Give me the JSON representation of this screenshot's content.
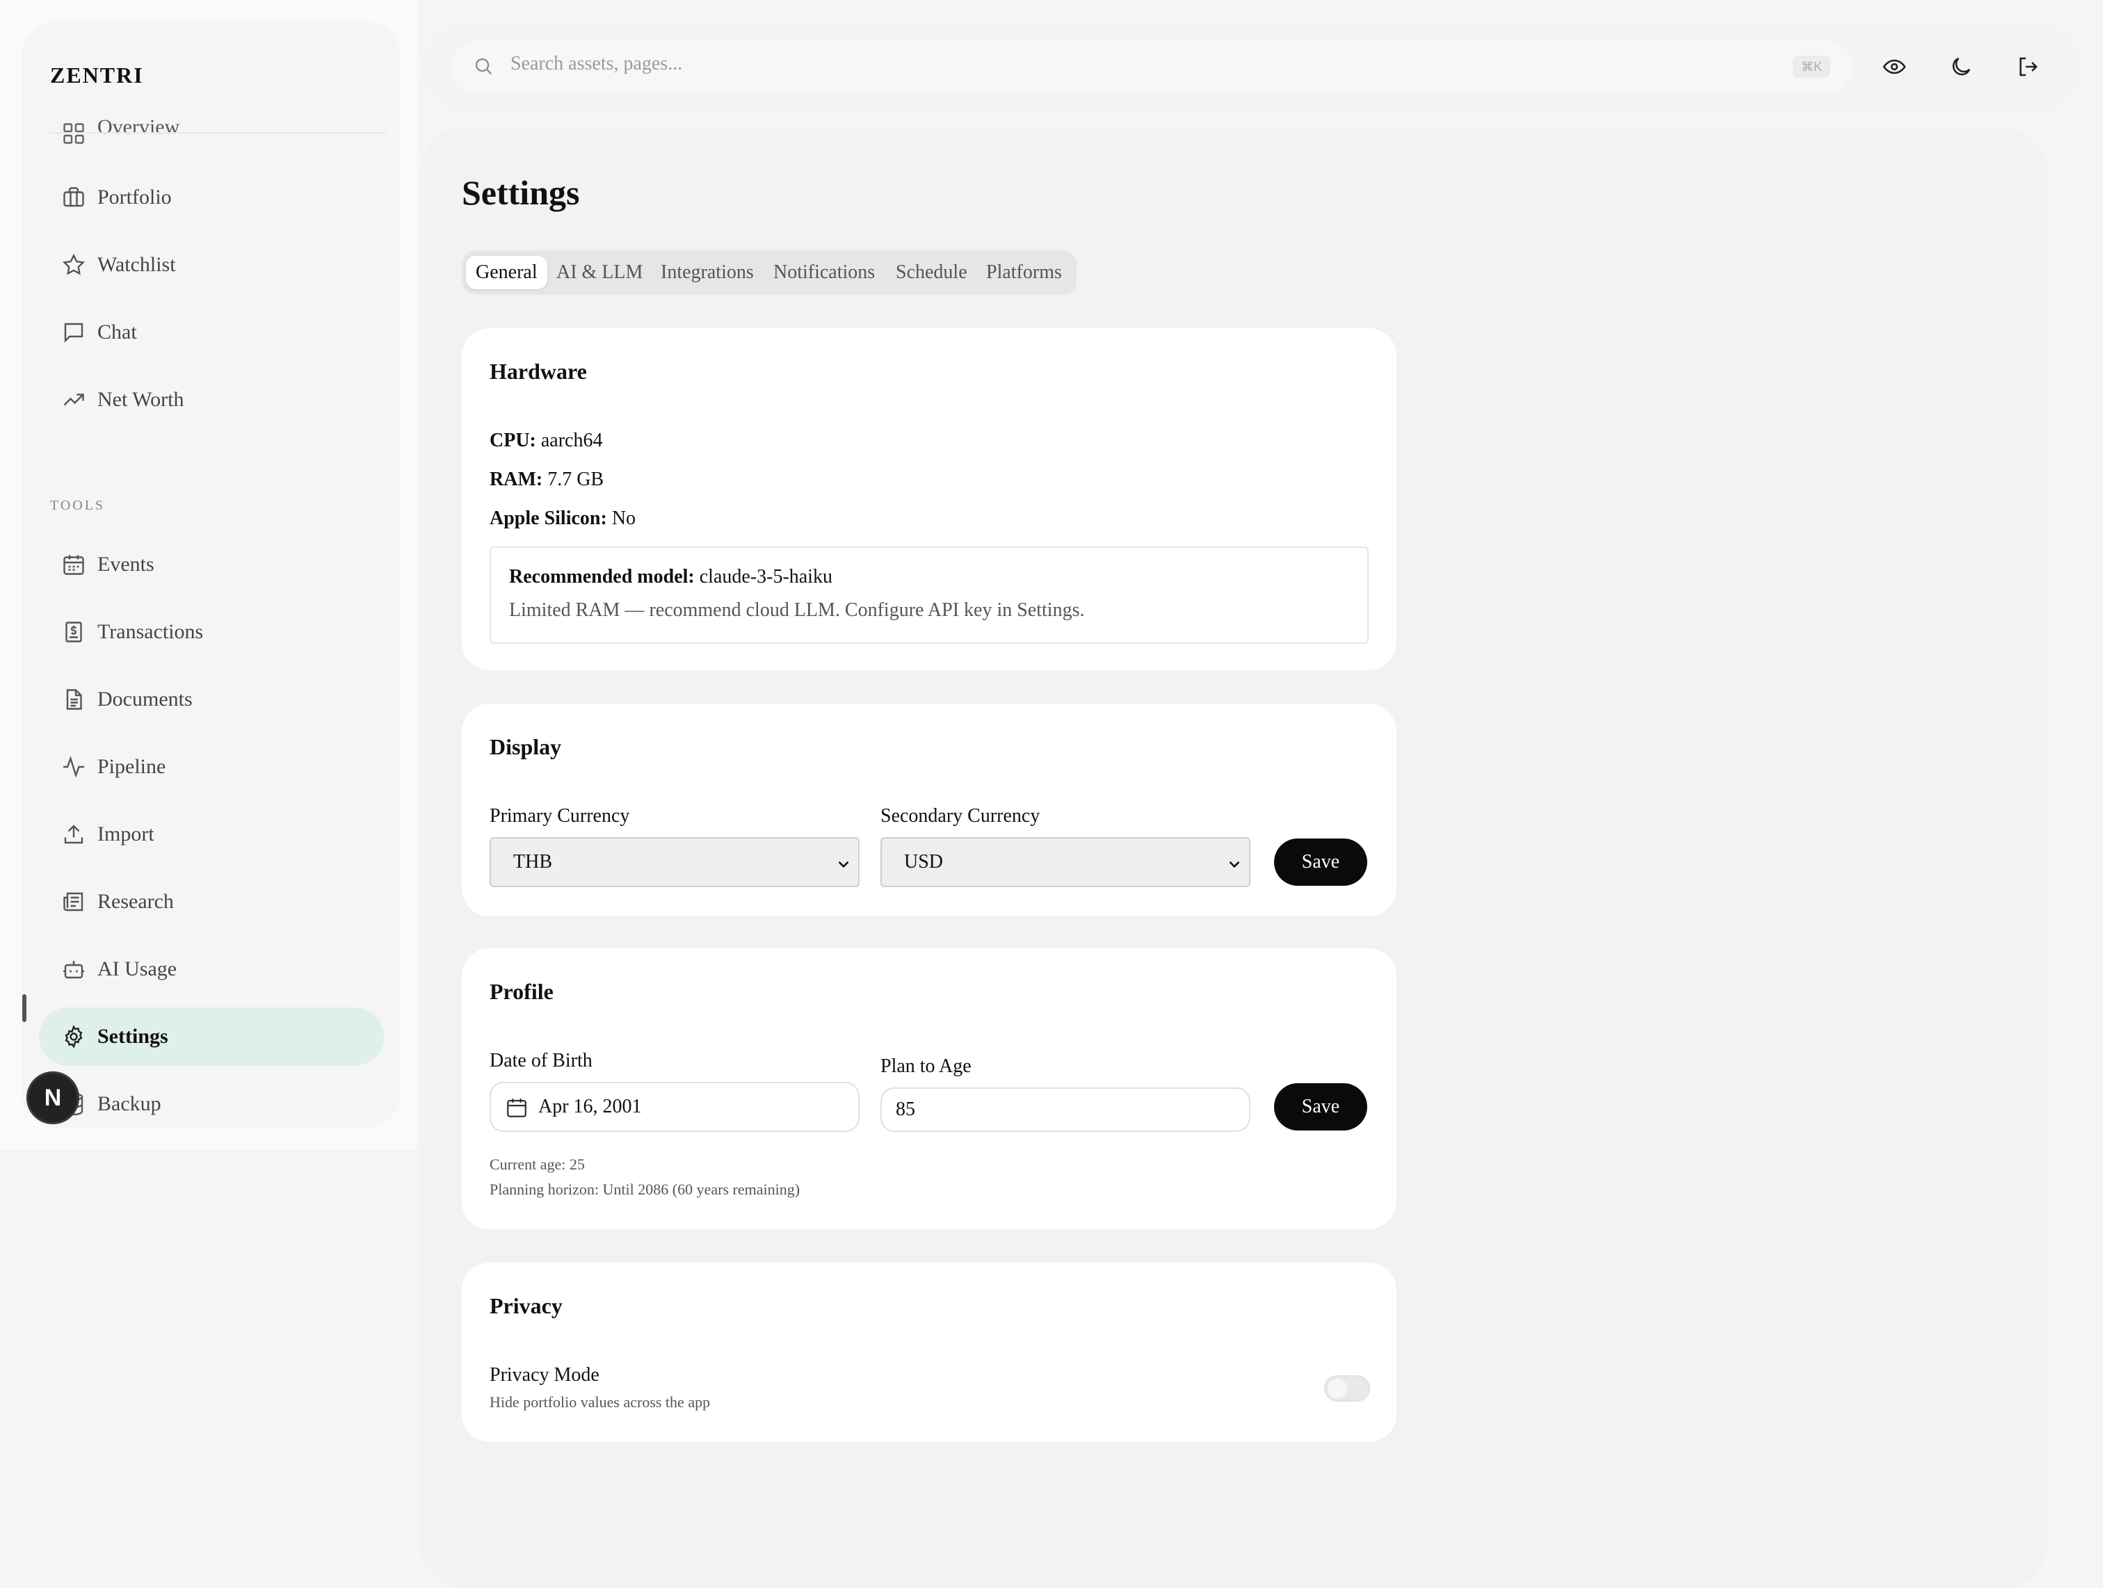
{
  "app": {
    "brand": "ZENTRI",
    "avatar_letter": "N"
  },
  "sidebar": {
    "items": [
      {
        "label": "Overview",
        "icon": "grid-icon"
      },
      {
        "label": "Portfolio",
        "icon": "briefcase-icon"
      },
      {
        "label": "Watchlist",
        "icon": "star-icon"
      },
      {
        "label": "Chat",
        "icon": "chat-icon"
      },
      {
        "label": "Net Worth",
        "icon": "trending-up-icon"
      }
    ],
    "tools_label": "TOOLS",
    "tools": [
      {
        "label": "Events",
        "icon": "calendar-icon"
      },
      {
        "label": "Transactions",
        "icon": "receipt-icon"
      },
      {
        "label": "Documents",
        "icon": "document-icon"
      },
      {
        "label": "Pipeline",
        "icon": "activity-icon"
      },
      {
        "label": "Import",
        "icon": "upload-icon"
      },
      {
        "label": "Research",
        "icon": "newspaper-icon"
      },
      {
        "label": "AI Usage",
        "icon": "bot-icon"
      },
      {
        "label": "Settings",
        "icon": "gear-icon",
        "active": true
      },
      {
        "label": "Backup",
        "icon": "database-icon"
      }
    ]
  },
  "topbar": {
    "search_placeholder": "Search assets, pages...",
    "search_shortcut": "⌘K",
    "icons": [
      "eye-icon",
      "moon-icon",
      "logout-icon"
    ]
  },
  "page": {
    "title": "Settings",
    "tabs": [
      "General",
      "AI & LLM",
      "Integrations",
      "Notifications",
      "Schedule",
      "Platforms"
    ],
    "active_tab": "General"
  },
  "hardware": {
    "title": "Hardware",
    "cpu_label": "CPU:",
    "cpu_value": "aarch64",
    "ram_label": "RAM:",
    "ram_value": "7.7 GB",
    "apple_label": "Apple Silicon:",
    "apple_value": "No",
    "rec_label": "Recommended model:",
    "rec_value": "claude-3-5-haiku",
    "rec_note": "Limited RAM — recommend cloud LLM. Configure API key in Settings."
  },
  "display": {
    "title": "Display",
    "primary_label": "Primary Currency",
    "primary_value": "THB",
    "secondary_label": "Secondary Currency",
    "secondary_value": "USD",
    "save_label": "Save"
  },
  "profile": {
    "title": "Profile",
    "dob_label": "Date of Birth",
    "dob_value": "Apr 16, 2001",
    "plan_label": "Plan to Age",
    "plan_value": "85",
    "save_label": "Save",
    "current_age": "Current age: 25",
    "horizon": "Planning horizon: Until 2086 (60 years remaining)"
  },
  "privacy": {
    "title": "Privacy",
    "mode_label": "Privacy Mode",
    "mode_desc": "Hide portfolio values across the app",
    "enabled": false
  }
}
